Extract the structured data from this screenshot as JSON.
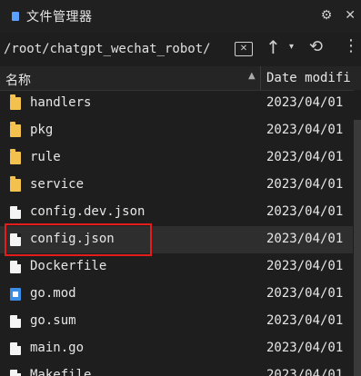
{
  "window": {
    "title": "文件管理器"
  },
  "title_actions": {
    "settings_glyph": "⚙",
    "close_glyph": "✕"
  },
  "path": {
    "value": "/root/chatgpt_wechat_robot/",
    "clear_glyph": "✕"
  },
  "nav": {
    "up_glyph": "↑",
    "dropdown_glyph": "▾",
    "sync_glyph": "⟲",
    "more_glyph": "⋮"
  },
  "header": {
    "name": "名称",
    "date": "Date modifi",
    "sort_glyph": "▲"
  },
  "files": [
    {
      "name": "handlers",
      "date": "2023/04/01",
      "type": "folder"
    },
    {
      "name": "pkg",
      "date": "2023/04/01",
      "type": "folder"
    },
    {
      "name": "rule",
      "date": "2023/04/01",
      "type": "folder"
    },
    {
      "name": "service",
      "date": "2023/04/01",
      "type": "folder"
    },
    {
      "name": "config.dev.json",
      "date": "2023/04/01",
      "type": "file"
    },
    {
      "name": "config.json",
      "date": "2023/04/01",
      "type": "file",
      "selected": true
    },
    {
      "name": "Dockerfile",
      "date": "2023/04/01",
      "type": "file"
    },
    {
      "name": "go.mod",
      "date": "2023/04/01",
      "type": "gofile"
    },
    {
      "name": "go.sum",
      "date": "2023/04/01",
      "type": "file"
    },
    {
      "name": "main.go",
      "date": "2023/04/01",
      "type": "file"
    },
    {
      "name": "Makefile",
      "date": "2023/04/01",
      "type": "file"
    }
  ],
  "colors": {
    "folder": "#f2c14e",
    "highlight": "#e31c1c",
    "background": "#1e1e1e"
  }
}
